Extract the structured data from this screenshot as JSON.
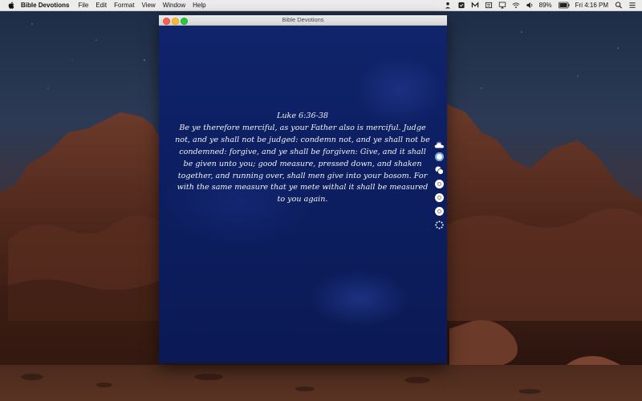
{
  "menubar": {
    "app_name": "Bible Devotions",
    "menus": [
      "File",
      "Edit",
      "Format",
      "View",
      "Window",
      "Help"
    ],
    "battery": "89%",
    "clock": "Fri 4:16 PM"
  },
  "window": {
    "title": "Bible Devotions"
  },
  "devotion": {
    "reference": "Luke 6:36-38",
    "text": "Be ye therefore merciful, as your Father also is merciful. Judge not, and ye shall not be judged: condemn not, and ye shall not be condemned: forgive, and ye shall be forgiven: Give, and it shall be given unto you; good measure, pressed down, and shaken together, and running over, shall men give into your bosom. For with the same measure that ye mete withal it shall be measured to you again."
  },
  "icons": {
    "apple": "apple-logo-icon",
    "status": [
      "user-icon",
      "shield-icon",
      "mail-icon",
      "grid-icon",
      "airplay-icon",
      "wifi-icon",
      "volume-icon",
      "battery-icon",
      "search-icon",
      "list-icon"
    ],
    "tools": [
      "weather-icon",
      "theme-blue-icon",
      "theme-split-icon",
      "theme-white-icon",
      "theme-white-icon",
      "theme-white-icon",
      "spinner-icon"
    ]
  }
}
